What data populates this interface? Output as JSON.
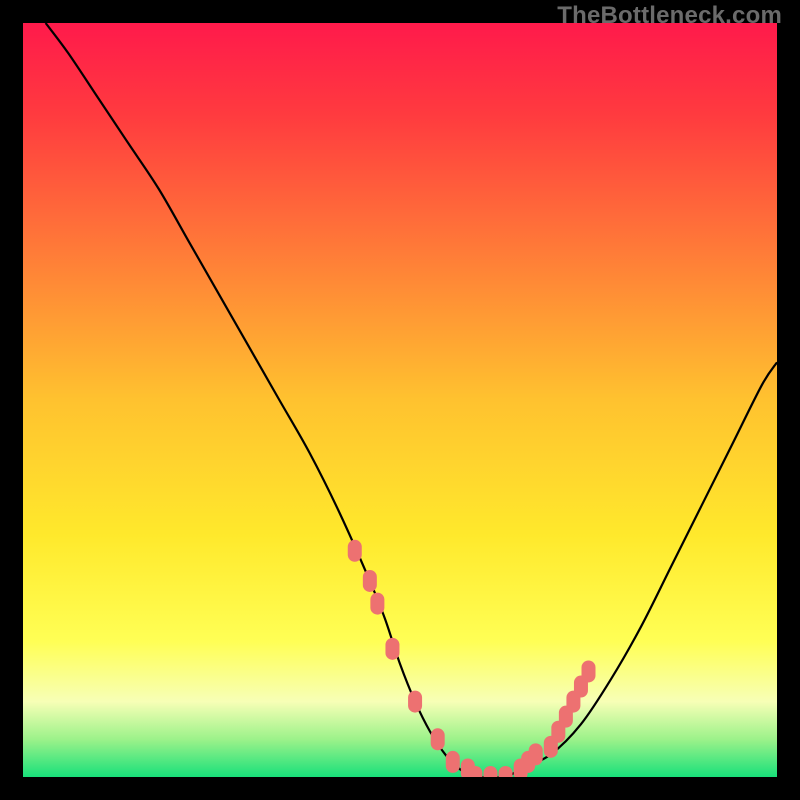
{
  "attribution": "TheBottleneck.com",
  "chart_data": {
    "type": "line",
    "title": "",
    "xlabel": "",
    "ylabel": "",
    "xlim": [
      0,
      100
    ],
    "ylim": [
      0,
      100
    ],
    "gradient_stops": [
      {
        "offset": 0.0,
        "color": "#ff1a4b"
      },
      {
        "offset": 0.12,
        "color": "#ff3a3f"
      },
      {
        "offset": 0.3,
        "color": "#ff7a38"
      },
      {
        "offset": 0.5,
        "color": "#ffc22f"
      },
      {
        "offset": 0.68,
        "color": "#ffe92c"
      },
      {
        "offset": 0.82,
        "color": "#ffff55"
      },
      {
        "offset": 0.9,
        "color": "#f7ffb6"
      },
      {
        "offset": 0.95,
        "color": "#9cf28a"
      },
      {
        "offset": 1.0,
        "color": "#18e07a"
      }
    ],
    "curve": {
      "x": [
        3,
        6,
        10,
        14,
        18,
        22,
        26,
        30,
        34,
        38,
        42,
        46,
        48,
        50,
        52,
        54,
        56,
        58,
        60,
        62,
        64,
        66,
        70,
        74,
        78,
        82,
        86,
        90,
        94,
        98,
        100
      ],
      "y": [
        100,
        96,
        90,
        84,
        78,
        71,
        64,
        57,
        50,
        43,
        35,
        26,
        21,
        15,
        10,
        6,
        3,
        1,
        0,
        0,
        0,
        1,
        3,
        7,
        13,
        20,
        28,
        36,
        44,
        52,
        55
      ]
    },
    "markers": {
      "x": [
        44,
        46,
        47,
        49,
        52,
        55,
        57,
        59,
        60,
        62,
        64,
        66,
        67,
        68,
        70,
        71,
        72,
        73,
        74,
        75
      ],
      "y": [
        30,
        26,
        23,
        17,
        10,
        5,
        2,
        1,
        0,
        0,
        0,
        1,
        2,
        3,
        4,
        6,
        8,
        10,
        12,
        14
      ]
    },
    "marker_color": "#ed7171",
    "curve_color": "#000000"
  }
}
